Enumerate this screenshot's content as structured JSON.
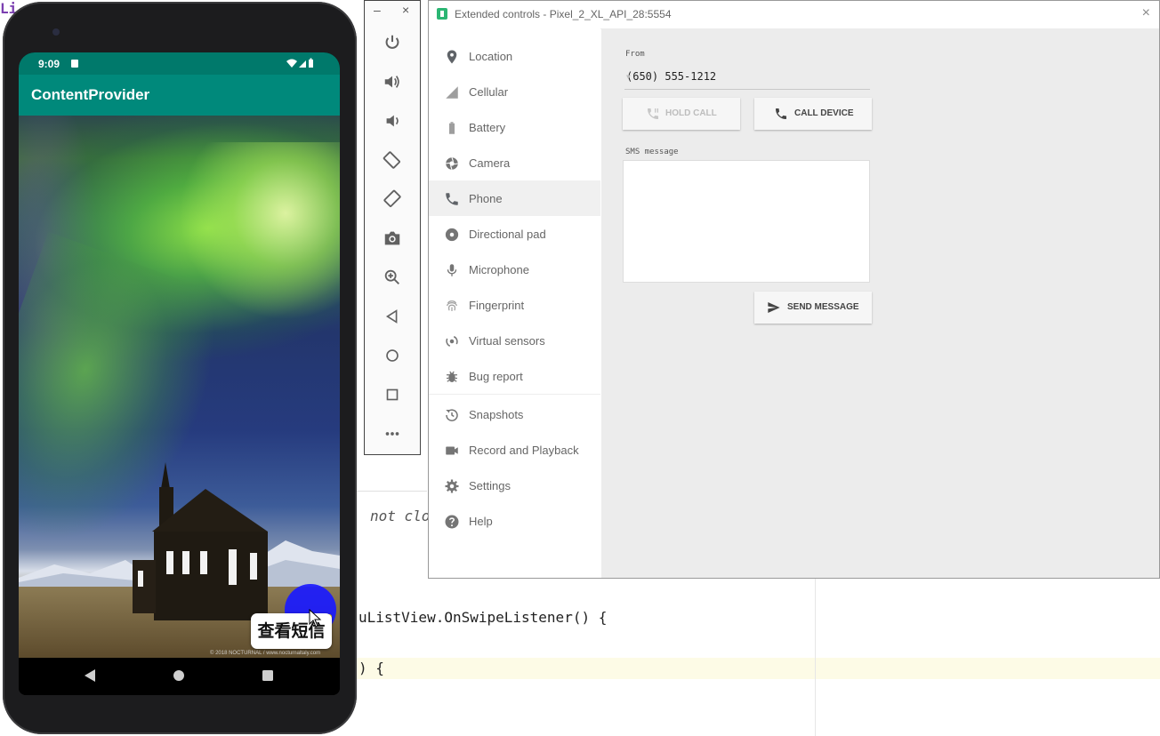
{
  "ide": {
    "fragments": {
      "f1": "Li",
      "f2": "not clo",
      "f3": "uListView.OnSwipeListener() {",
      "f4": ") {"
    }
  },
  "phone": {
    "status_time": "9:09",
    "app_title": "ContentProvider",
    "view_sms_button": "查看短信",
    "watermark": "© 2018 NOCTURNAL / www.nocturnaltaly.com"
  },
  "toolbar": {
    "minimize": "–",
    "close": "×",
    "icons": [
      "power-icon",
      "volume-up-icon",
      "volume-down-icon",
      "rotate-left-icon",
      "rotate-right-icon",
      "camera-icon",
      "zoom-icon",
      "back-icon",
      "home-icon",
      "overview-icon",
      "more-icon"
    ]
  },
  "extended_controls": {
    "window_title": "Extended controls - Pixel_2_XL_API_28:5554",
    "close": "×",
    "sidebar": [
      {
        "label": "Location",
        "icon": "location-icon"
      },
      {
        "label": "Cellular",
        "icon": "cellular-icon"
      },
      {
        "label": "Battery",
        "icon": "battery-icon"
      },
      {
        "label": "Camera",
        "icon": "camera-icon"
      },
      {
        "label": "Phone",
        "icon": "phone-icon",
        "active": true
      },
      {
        "label": "Directional pad",
        "icon": "dpad-icon"
      },
      {
        "label": "Microphone",
        "icon": "microphone-icon"
      },
      {
        "label": "Fingerprint",
        "icon": "fingerprint-icon"
      },
      {
        "label": "Virtual sensors",
        "icon": "sensors-icon"
      },
      {
        "label": "Bug report",
        "icon": "bug-icon"
      },
      {
        "label": "Snapshots",
        "icon": "snapshots-icon"
      },
      {
        "label": "Record and Playback",
        "icon": "record-icon"
      },
      {
        "label": "Settings",
        "icon": "settings-icon"
      },
      {
        "label": "Help",
        "icon": "help-icon"
      }
    ],
    "phone_panel": {
      "from_label": "From",
      "from_value": "(650) 555-1212",
      "hold_call": "HOLD CALL",
      "call_device": "CALL DEVICE",
      "sms_label": "SMS message",
      "sms_value": "",
      "send_message": "SEND MESSAGE"
    }
  },
  "colors": {
    "status_bar": "#00796b",
    "app_bar": "#00897b",
    "fab": "#1a1aff"
  }
}
